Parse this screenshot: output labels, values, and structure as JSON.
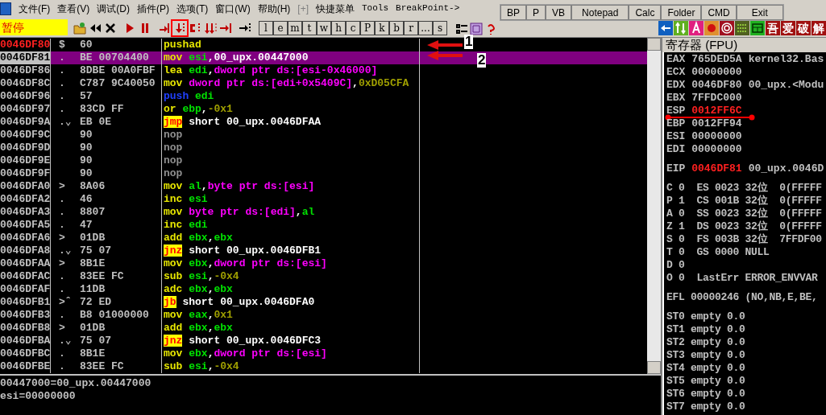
{
  "menu": {
    "items": [
      "文件(F)",
      "查看(V)",
      "调试(D)",
      "插件(P)",
      "选项(T)",
      "窗口(W)",
      "帮助(H)",
      "[+]",
      "快捷菜单",
      "Tools",
      "BreakPoint->"
    ]
  },
  "toolbar": {
    "status": "暂停",
    "tools": [
      {
        "kind": "open",
        "marked": false
      },
      {
        "kind": "rewind",
        "marked": false
      },
      {
        "kind": "close",
        "marked": false
      },
      {
        "kind": "run",
        "marked": false
      },
      {
        "kind": "pause",
        "marked": false
      },
      {
        "kind": "step-into",
        "marked": false
      },
      {
        "kind": "step-over",
        "marked": true
      },
      {
        "kind": "trace-into",
        "marked": false
      },
      {
        "kind": "trace-over",
        "marked": false
      },
      {
        "kind": "till-return",
        "marked": false
      },
      {
        "kind": "goto",
        "marked": false
      }
    ],
    "letters": [
      "l",
      "e",
      "m",
      "t",
      "w",
      "h",
      "c",
      "P",
      "k",
      "b",
      "r",
      "...",
      "s"
    ],
    "brand_tiles": [
      "吾",
      "爱",
      "破",
      "解"
    ]
  },
  "quick_bar": {
    "buttons": [
      "BP",
      "P",
      "VB",
      "Notepad",
      "Calc",
      "Folder",
      "CMD",
      "Exit"
    ]
  },
  "disassembly": {
    "rows": [
      {
        "address": "0046DF80",
        "mark": "$",
        "hex": "60",
        "current": true,
        "selected": false,
        "code": [
          {
            "kind": "op",
            "text": "pushad"
          }
        ]
      },
      {
        "address": "0046DF81",
        "mark": ".",
        "hex": "BE 00704400",
        "current": false,
        "selected": true,
        "code": [
          {
            "kind": "op",
            "text": "mov "
          },
          {
            "kind": "reg",
            "text": "esi"
          },
          {
            "kind": "text",
            "text": ",00_upx.00447000"
          }
        ]
      },
      {
        "address": "0046DF86",
        "mark": ".",
        "hex": "8DBE 00A0FBF",
        "current": false,
        "selected": false,
        "code": [
          {
            "kind": "op",
            "text": "lea "
          },
          {
            "kind": "reg",
            "text": "edi"
          },
          {
            "kind": "text",
            "text": ","
          },
          {
            "kind": "mem",
            "text": "dword ptr ds:[esi-0x46000]"
          }
        ]
      },
      {
        "address": "0046DF8C",
        "mark": ".",
        "hex": "C787 9C40050",
        "current": false,
        "selected": false,
        "code": [
          {
            "kind": "op",
            "text": "mov "
          },
          {
            "kind": "mem",
            "text": "dword ptr ds:[edi+0x5409C]"
          },
          {
            "kind": "text",
            "text": ","
          },
          {
            "kind": "imm",
            "text": "0xD05CFA"
          }
        ]
      },
      {
        "address": "0046DF96",
        "mark": ".",
        "hex": "57",
        "current": false,
        "selected": false,
        "code": [
          {
            "kind": "push",
            "text": "push "
          },
          {
            "kind": "reg",
            "text": "edi"
          }
        ]
      },
      {
        "address": "0046DF97",
        "mark": ".",
        "hex": "83CD FF",
        "current": false,
        "selected": false,
        "code": [
          {
            "kind": "op",
            "text": "or "
          },
          {
            "kind": "reg",
            "text": "ebp"
          },
          {
            "kind": "text",
            "text": ","
          },
          {
            "kind": "imm",
            "text": "-0x1"
          }
        ]
      },
      {
        "address": "0046DF9A",
        "mark": ".⌄",
        "hex": "EB 0E",
        "current": false,
        "selected": false,
        "code": [
          {
            "kind": "jmp",
            "text": "jmp"
          },
          {
            "kind": "text",
            "text": " short 00_upx.0046DFAA"
          }
        ]
      },
      {
        "address": "0046DF9C",
        "mark": "",
        "hex": "90",
        "current": false,
        "selected": false,
        "code": [
          {
            "kind": "nop",
            "text": "nop"
          }
        ]
      },
      {
        "address": "0046DF9D",
        "mark": "",
        "hex": "90",
        "current": false,
        "selected": false,
        "code": [
          {
            "kind": "nop",
            "text": "nop"
          }
        ]
      },
      {
        "address": "0046DF9E",
        "mark": "",
        "hex": "90",
        "current": false,
        "selected": false,
        "code": [
          {
            "kind": "nop",
            "text": "nop"
          }
        ]
      },
      {
        "address": "0046DF9F",
        "mark": "",
        "hex": "90",
        "current": false,
        "selected": false,
        "code": [
          {
            "kind": "nop",
            "text": "nop"
          }
        ]
      },
      {
        "address": "0046DFA0",
        "mark": ">",
        "hex": "8A06",
        "current": false,
        "selected": false,
        "code": [
          {
            "kind": "op",
            "text": "mov "
          },
          {
            "kind": "reg",
            "text": "al"
          },
          {
            "kind": "text",
            "text": ","
          },
          {
            "kind": "mem",
            "text": "byte ptr ds:[esi]"
          }
        ]
      },
      {
        "address": "0046DFA2",
        "mark": ".",
        "hex": "46",
        "current": false,
        "selected": false,
        "code": [
          {
            "kind": "op",
            "text": "inc "
          },
          {
            "kind": "reg",
            "text": "esi"
          }
        ]
      },
      {
        "address": "0046DFA3",
        "mark": ".",
        "hex": "8807",
        "current": false,
        "selected": false,
        "code": [
          {
            "kind": "op",
            "text": "mov "
          },
          {
            "kind": "mem",
            "text": "byte ptr ds:[edi]"
          },
          {
            "kind": "text",
            "text": ","
          },
          {
            "kind": "reg",
            "text": "al"
          }
        ]
      },
      {
        "address": "0046DFA5",
        "mark": ".",
        "hex": "47",
        "current": false,
        "selected": false,
        "code": [
          {
            "kind": "op",
            "text": "inc "
          },
          {
            "kind": "reg",
            "text": "edi"
          }
        ]
      },
      {
        "address": "0046DFA6",
        "mark": ">",
        "hex": "01DB",
        "current": false,
        "selected": false,
        "code": [
          {
            "kind": "op",
            "text": "add "
          },
          {
            "kind": "reg",
            "text": "ebx"
          },
          {
            "kind": "text",
            "text": ","
          },
          {
            "kind": "reg",
            "text": "ebx"
          }
        ]
      },
      {
        "address": "0046DFA8",
        "mark": ".⌄",
        "hex": "75 07",
        "current": false,
        "selected": false,
        "code": [
          {
            "kind": "jmp",
            "text": "jnz"
          },
          {
            "kind": "text",
            "text": " short 00_upx.0046DFB1"
          }
        ]
      },
      {
        "address": "0046DFAA",
        "mark": ">",
        "hex": "8B1E",
        "current": false,
        "selected": false,
        "code": [
          {
            "kind": "op",
            "text": "mov "
          },
          {
            "kind": "reg",
            "text": "ebx"
          },
          {
            "kind": "text",
            "text": ","
          },
          {
            "kind": "mem",
            "text": "dword ptr ds:[esi]"
          }
        ]
      },
      {
        "address": "0046DFAC",
        "mark": ".",
        "hex": "83EE FC",
        "current": false,
        "selected": false,
        "code": [
          {
            "kind": "op",
            "text": "sub "
          },
          {
            "kind": "reg",
            "text": "esi"
          },
          {
            "kind": "text",
            "text": ","
          },
          {
            "kind": "imm",
            "text": "-0x4"
          }
        ]
      },
      {
        "address": "0046DFAF",
        "mark": ".",
        "hex": "11DB",
        "current": false,
        "selected": false,
        "code": [
          {
            "kind": "op",
            "text": "adc "
          },
          {
            "kind": "reg",
            "text": "ebx"
          },
          {
            "kind": "text",
            "text": ","
          },
          {
            "kind": "reg",
            "text": "ebx"
          }
        ]
      },
      {
        "address": "0046DFB1",
        "mark": ">ˆ",
        "hex": "72 ED",
        "current": false,
        "selected": false,
        "code": [
          {
            "kind": "jmp",
            "text": "jb"
          },
          {
            "kind": "text",
            "text": " short 00_upx.0046DFA0"
          }
        ]
      },
      {
        "address": "0046DFB3",
        "mark": ".",
        "hex": "B8 01000000",
        "current": false,
        "selected": false,
        "code": [
          {
            "kind": "op",
            "text": "mov "
          },
          {
            "kind": "reg",
            "text": "eax"
          },
          {
            "kind": "text",
            "text": ","
          },
          {
            "kind": "imm",
            "text": "0x1"
          }
        ]
      },
      {
        "address": "0046DFB8",
        "mark": ">",
        "hex": "01DB",
        "current": false,
        "selected": false,
        "code": [
          {
            "kind": "op",
            "text": "add "
          },
          {
            "kind": "reg",
            "text": "ebx"
          },
          {
            "kind": "text",
            "text": ","
          },
          {
            "kind": "reg",
            "text": "ebx"
          }
        ]
      },
      {
        "address": "0046DFBA",
        "mark": ".⌄",
        "hex": "75 07",
        "current": false,
        "selected": false,
        "code": [
          {
            "kind": "jmp",
            "text": "jnz"
          },
          {
            "kind": "text",
            "text": " short 00_upx.0046DFC3"
          }
        ]
      },
      {
        "address": "0046DFBC",
        "mark": ".",
        "hex": "8B1E",
        "current": false,
        "selected": false,
        "code": [
          {
            "kind": "op",
            "text": "mov "
          },
          {
            "kind": "reg",
            "text": "ebx"
          },
          {
            "kind": "text",
            "text": ","
          },
          {
            "kind": "mem",
            "text": "dword ptr ds:[esi]"
          }
        ]
      },
      {
        "address": "0046DFBE",
        "mark": ".",
        "hex": "83EE FC",
        "current": false,
        "selected": false,
        "code": [
          {
            "kind": "op",
            "text": "sub "
          },
          {
            "kind": "reg",
            "text": "esi"
          },
          {
            "kind": "text",
            "text": ","
          },
          {
            "kind": "imm",
            "text": "-0x4"
          }
        ]
      }
    ]
  },
  "info_pane": {
    "lines": [
      "00447000=00_upx.00447000",
      "esi=00000000"
    ]
  },
  "annotations": {
    "arrows": [
      "1",
      "2"
    ]
  },
  "registers": {
    "title": "寄存器 (FPU)",
    "lines": [
      {
        "kind": "reg",
        "name": "EAX",
        "value": "765DED5A",
        "changed": false,
        "comment": "kernel32.Bas"
      },
      {
        "kind": "reg",
        "name": "ECX",
        "value": "00000000",
        "changed": false
      },
      {
        "kind": "reg",
        "name": "EDX",
        "value": "0046DF80",
        "changed": false,
        "comment": "00_upx.<Modu"
      },
      {
        "kind": "reg",
        "name": "EBX",
        "value": "7FFDC000",
        "changed": false
      },
      {
        "kind": "reg",
        "name": "ESP",
        "value": "0012FF6C",
        "changed": true,
        "underlined": true
      },
      {
        "kind": "reg",
        "name": "EBP",
        "value": "0012FF94",
        "changed": false
      },
      {
        "kind": "reg",
        "name": "ESI",
        "value": "00000000",
        "changed": false
      },
      {
        "kind": "reg",
        "name": "EDI",
        "value": "00000000",
        "changed": false
      },
      {
        "kind": "gap"
      },
      {
        "kind": "reg",
        "name": "EIP",
        "value": "0046DF81",
        "changed": true,
        "comment": "00_upx.0046D"
      },
      {
        "kind": "gap"
      },
      {
        "kind": "text",
        "text": "C 0  ES 0023 32位  0(FFFFF"
      },
      {
        "kind": "text",
        "text": "P 1  CS 001B 32位  0(FFFFF"
      },
      {
        "kind": "text",
        "text": "A 0  SS 0023 32位  0(FFFFF"
      },
      {
        "kind": "text",
        "text": "Z 1  DS 0023 32位  0(FFFFF"
      },
      {
        "kind": "text",
        "text": "S 0  FS 003B 32位  7FFDF00"
      },
      {
        "kind": "text",
        "text": "T 0  GS 0000 NULL"
      },
      {
        "kind": "text",
        "text": "D 0"
      },
      {
        "kind": "text",
        "text": "O 0  LastErr ERROR_ENVVAR"
      },
      {
        "kind": "gap"
      },
      {
        "kind": "text",
        "text": "EFL 00000246 (NO,NB,E,BE,"
      },
      {
        "kind": "gap"
      },
      {
        "kind": "text",
        "text": "ST0 empty 0.0"
      },
      {
        "kind": "text",
        "text": "ST1 empty 0.0"
      },
      {
        "kind": "text",
        "text": "ST2 empty 0.0"
      },
      {
        "kind": "text",
        "text": "ST3 empty 0.0"
      },
      {
        "kind": "text",
        "text": "ST4 empty 0.0"
      },
      {
        "kind": "text",
        "text": "ST5 empty 0.0"
      },
      {
        "kind": "text",
        "text": "ST6 empty 0.0"
      },
      {
        "kind": "text",
        "text": "ST7 empty 0.0"
      }
    ]
  }
}
